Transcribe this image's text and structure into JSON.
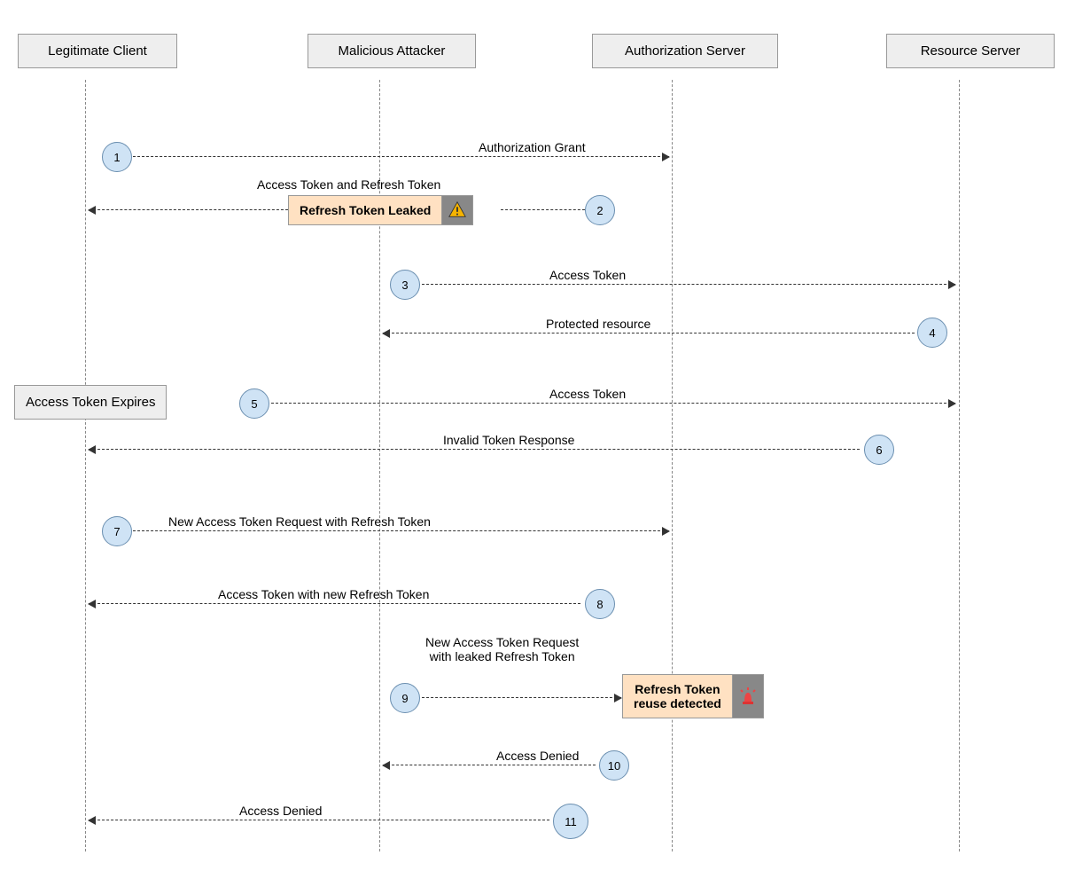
{
  "participants": {
    "client": "Legitimate Client",
    "attacker": "Malicious Attacker",
    "auth": "Authorization Server",
    "resource": "Resource Server"
  },
  "event": {
    "expires": "Access Token Expires"
  },
  "notes": {
    "leaked": "Refresh Token Leaked",
    "detected": "Refresh Token\nreuse detected"
  },
  "steps": {
    "s1": "1",
    "s2": "2",
    "s3": "3",
    "s4": "4",
    "s5": "5",
    "s6": "6",
    "s7": "7",
    "s8": "8",
    "s9": "9",
    "s10": "10",
    "s11": "11"
  },
  "messages": {
    "m1": "Authorization Grant",
    "m2a": "Access Token  and Refresh Token",
    "m3": "Access Token",
    "m4": "Protected resource",
    "m5": "Access Token",
    "m6": "Invalid Token Response",
    "m7": "New Access Token Request with Refresh Token",
    "m8": "Access Token with new Refresh Token",
    "m9": "New Access Token Request\nwith leaked Refresh Token",
    "m10": "Access Denied",
    "m11": "Access Denied"
  }
}
